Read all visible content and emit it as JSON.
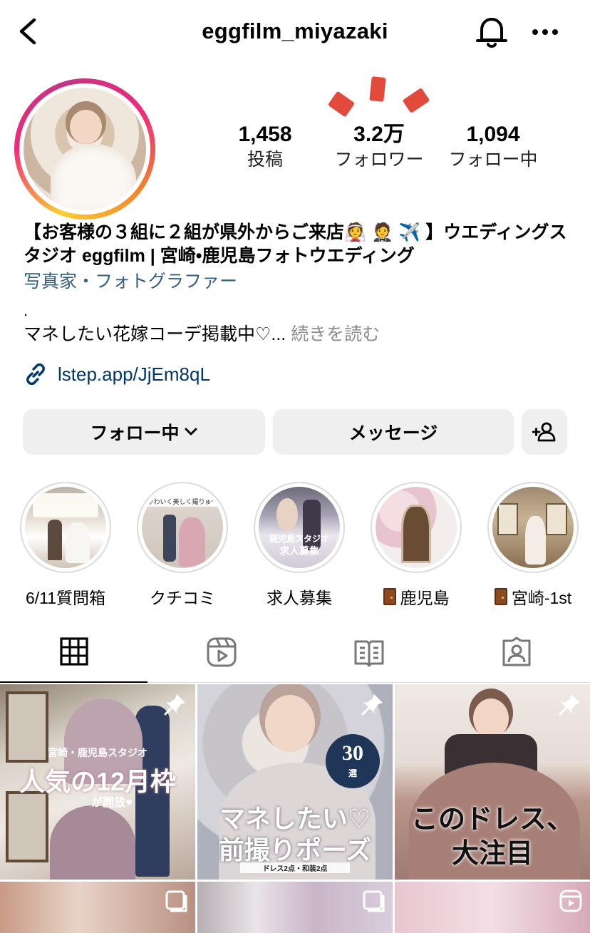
{
  "header": {
    "username": "eggfilm_miyazaki",
    "back_icon": "chevron-left-icon",
    "bell_icon": "bell-icon",
    "more_icon": "more-horizontal-icon"
  },
  "profile": {
    "stats": [
      {
        "value": "1,458",
        "label": "投稿"
      },
      {
        "value": "3.2万",
        "label": "フォロワー"
      },
      {
        "value": "1,094",
        "label": "フォロー中"
      }
    ]
  },
  "bio": {
    "name": "【お客様の３組に２組が県外からご来店👰 🤵 ✈️ 】ウエディングスタジオ eggfilm | 宮崎•鹿児島フォトウエディング",
    "category": "写真家・フォトグラファー",
    "dot": ".",
    "text": "マネしたい花嫁コーデ掲載中♡... ",
    "more_label": "続きを読む",
    "link": "lstep.app/JjEm8qL"
  },
  "actions": {
    "follow_label": "フォロー中",
    "message_label": "メッセージ"
  },
  "highlights": [
    {
      "label": "6/11質問箱"
    },
    {
      "label": "クチコミ"
    },
    {
      "label": "求人募集"
    },
    {
      "label": "鹿児島"
    },
    {
      "label": "宮崎-1st"
    }
  ],
  "highlight_overlays": {
    "h2_top": "かわいく美しく撮りゅ〜",
    "h3_line1": "鹿児島スタジオ",
    "h3_line2": "求人募集"
  },
  "tabs": [
    "grid-icon",
    "reels-icon",
    "guide-icon",
    "tagged-icon"
  ],
  "posts": [
    {
      "line1": "宮崎・鹿児島スタジオ",
      "line2": "人気の12月枠",
      "line3": "が開放♥"
    },
    {
      "badge_num": "30",
      "badge_sub": "選",
      "line1": "マネしたい♡",
      "line2": "前撮りポーズ",
      "line3": "ドレス2点・和装2点"
    },
    {
      "line1": "このドレス、",
      "line2": "大注目"
    }
  ],
  "colors": {
    "link": "#00376b",
    "category": "#34607e",
    "button_bg": "#efefef",
    "muted": "#8e8e8e"
  }
}
